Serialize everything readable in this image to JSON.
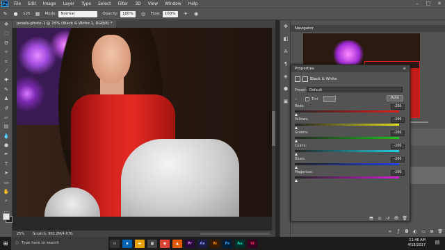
{
  "app": {
    "logo": "Ps",
    "menu": [
      "File",
      "Edit",
      "Image",
      "Layer",
      "Type",
      "Select",
      "Filter",
      "3D",
      "View",
      "Window",
      "Help"
    ],
    "window_controls": [
      "minimize-icon",
      "maximize-icon",
      "close-icon"
    ]
  },
  "options": {
    "brush_size": "125",
    "mode_label": "Mode:",
    "mode_value": "Normal",
    "opacity_label": "Opacity:",
    "opacity_value": "100%",
    "flow_label": "Flow:",
    "flow_value": "100%"
  },
  "document": {
    "tab_title": "pexels-photo-1 @ 25% (Black & White 1, RGB/8) *",
    "zoom": "25%",
    "scratch": "Scratch: 901.2M/4.67G"
  },
  "tools": [
    "move-icon",
    "marquee-icon",
    "lasso-icon",
    "quick-select-icon",
    "crop-icon",
    "eyedropper-icon",
    "healing-icon",
    "brush-icon",
    "clone-stamp-icon",
    "history-brush-icon",
    "eraser-icon",
    "gradient-icon",
    "blur-icon",
    "dodge-icon",
    "pen-icon",
    "type-icon",
    "path-select-icon",
    "shape-icon",
    "hand-icon",
    "zoom-icon",
    "more-tools-icon"
  ],
  "navigator": {
    "title": "Navigator"
  },
  "properties": {
    "title": "Properties",
    "adjustment": "Black & White",
    "preset_label": "Preset:",
    "preset_value": "Default",
    "tint_label": "Tint",
    "auto_label": "Auto",
    "sliders": [
      {
        "label": "Reds:",
        "value": "-200",
        "gradient": "linear-gradient(90deg,#222,#e02020)"
      },
      {
        "label": "Yellows:",
        "value": "-200",
        "gradient": "linear-gradient(90deg,#222,#e0e020)"
      },
      {
        "label": "Greens:",
        "value": "-200",
        "gradient": "linear-gradient(90deg,#222,#20c020)"
      },
      {
        "label": "Cyans:",
        "value": "-200",
        "gradient": "linear-gradient(90deg,#222,#20d0e0)"
      },
      {
        "label": "Blues:",
        "value": "-200",
        "gradient": "linear-gradient(90deg,#222,#2040e0)"
      },
      {
        "label": "Magentas:",
        "value": "-200",
        "gradient": "linear-gradient(90deg,#222,#d020d0)"
      }
    ]
  },
  "taskbar": {
    "search_placeholder": "Type here to search",
    "apps": [
      {
        "name": "Pr",
        "color": "#2a0a3a"
      },
      {
        "name": "Ae",
        "color": "#1a1a44"
      },
      {
        "name": "Ai",
        "color": "#3a1a00"
      },
      {
        "name": "Ps",
        "color": "#001e36"
      },
      {
        "name": "Au",
        "color": "#00302a"
      },
      {
        "name": "Id",
        "color": "#3a0020"
      }
    ],
    "time": "11:46 AM",
    "date": "4/18/2017"
  }
}
